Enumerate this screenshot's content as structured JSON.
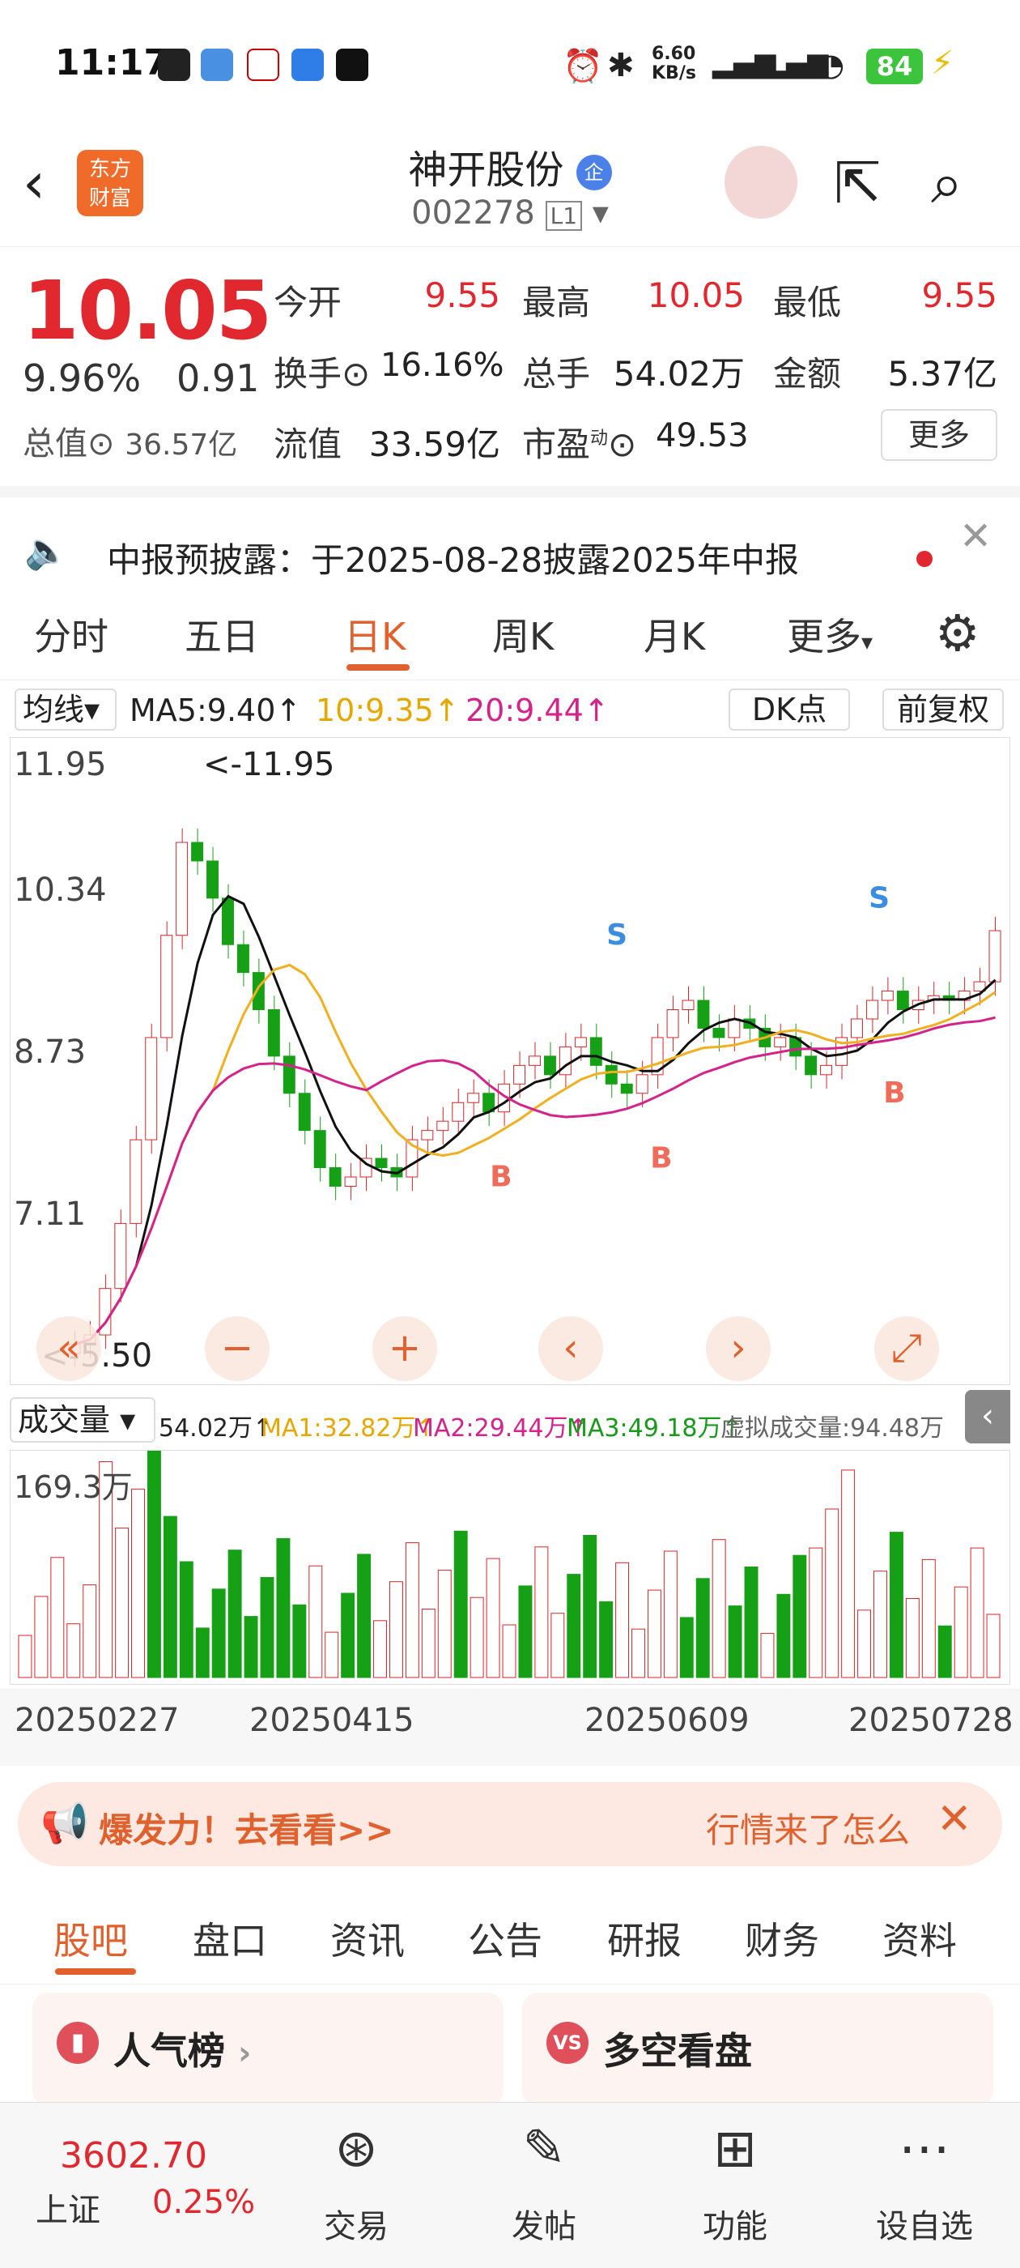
{
  "status": {
    "time": "11:17",
    "net_speed": "6.60",
    "net_unit": "KB/s",
    "battery": "84"
  },
  "header": {
    "name": "神开股份",
    "badge": "企",
    "code": "002278",
    "level": "L1",
    "logo_line1": "东方",
    "logo_line2": "财富"
  },
  "quote": {
    "price": "10.05",
    "pct": "9.96%",
    "chg": "0.91",
    "today_open_label": "今开",
    "today_open": "9.55",
    "high_label": "最高",
    "high": "10.05",
    "low_label": "最低",
    "low": "9.55",
    "turnover_label": "换手",
    "turnover": "16.16%",
    "volume_label": "总手",
    "volume": "54.02万",
    "amount_label": "金额",
    "amount": "5.37亿",
    "mcap_label": "总值",
    "mcap": "36.57亿",
    "float_label": "流值",
    "float": "33.59亿",
    "pe_label": "市盈",
    "pe_sup": "动",
    "pe": "49.53",
    "more_label": "更多"
  },
  "notice": {
    "text": "中报预披露：于2025-08-28披露2025年中报"
  },
  "tabs": [
    "分时",
    "五日",
    "日K",
    "周K",
    "月K",
    "更多"
  ],
  "active_tab": "日K",
  "ma": {
    "selector": "均线",
    "ma5": "MA5:9.40",
    "ma10": "10:9.35",
    "ma20": "20:9.44",
    "dk": "DK点",
    "fq": "前复权"
  },
  "chart_data": {
    "type": "candlestick",
    "y_ticks": [
      "11.95",
      "10.34",
      "8.73",
      "7.11"
    ],
    "high_annotation": "<-11.95",
    "low_annotation": "<-5.50",
    "ylim": [
      5.5,
      11.95
    ],
    "signals": [
      {
        "label": "S"
      },
      {
        "label": "S"
      },
      {
        "label": "B"
      },
      {
        "label": "B"
      },
      {
        "label": "B"
      }
    ],
    "closes": [
      5.6,
      5.7,
      6.2,
      6.9,
      7.8,
      8.9,
      10.0,
      11.0,
      10.8,
      10.4,
      9.9,
      9.6,
      9.2,
      8.7,
      8.3,
      7.9,
      7.5,
      7.3,
      7.4,
      7.6,
      7.5,
      7.4,
      7.8,
      7.9,
      8.0,
      8.2,
      8.3,
      8.1,
      8.4,
      8.6,
      8.7,
      8.5,
      8.8,
      8.9,
      8.6,
      8.4,
      8.3,
      8.5,
      8.9,
      9.2,
      9.3,
      9.0,
      8.9,
      9.1,
      9.0,
      8.8,
      8.9,
      8.7,
      8.5,
      8.6,
      8.9,
      9.1,
      9.3,
      9.4,
      9.2,
      9.3,
      9.35,
      9.3,
      9.4,
      9.5,
      10.05
    ]
  },
  "volume": {
    "selector": "成交量",
    "vol": "54.02万",
    "ma1": "MA1:32.82万",
    "ma2": "MA2:29.44万",
    "ma3": "MA3:49.18万",
    "virtual": "虚拟成交量:94.48万",
    "ymax": "169.3万"
  },
  "dates": [
    "20250227",
    "20250415",
    "20250609",
    "20250728"
  ],
  "banner": {
    "left": "爆发力！去看看>>",
    "right": "行情来了怎么"
  },
  "subtabs": [
    "股吧",
    "盘口",
    "资讯",
    "公告",
    "研报",
    "财务",
    "资料"
  ],
  "cards": [
    {
      "title": "人气榜"
    },
    {
      "title": "多空看盘"
    }
  ],
  "bottom": {
    "index_value": "3602.70",
    "index_name": "上证",
    "index_pct": "0.25%",
    "items": [
      "交易",
      "发帖",
      "功能",
      "设自选"
    ]
  }
}
